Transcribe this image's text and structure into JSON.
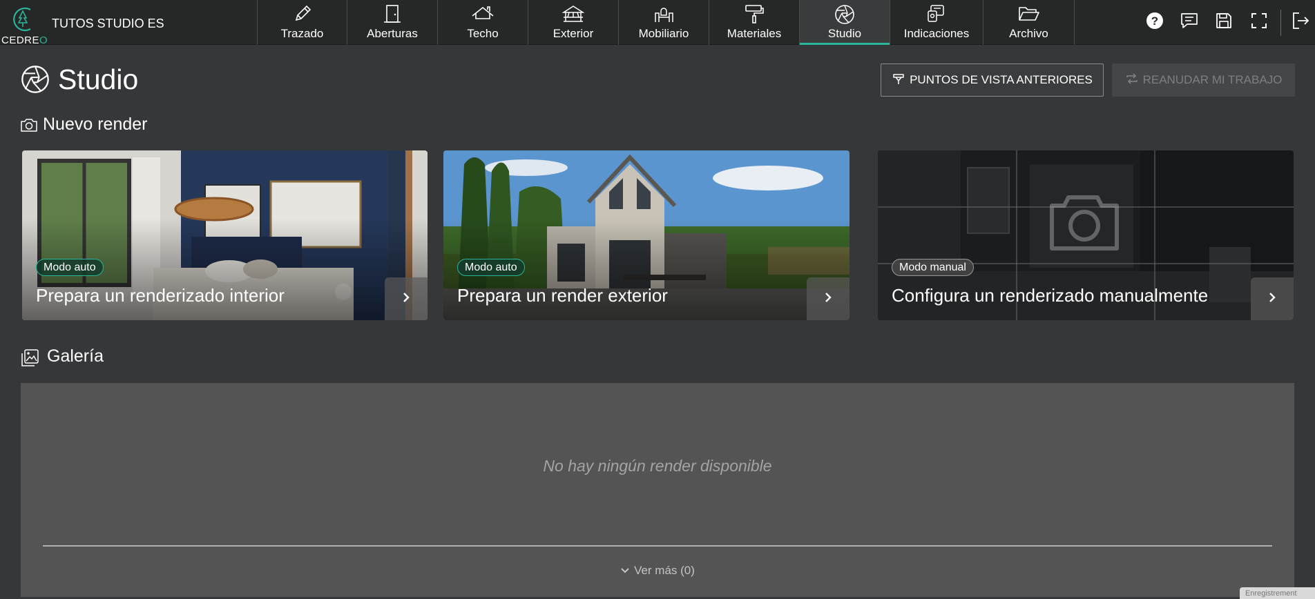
{
  "brand": {
    "logo_text_main": "CEDRE",
    "logo_text_accent": "O"
  },
  "project": {
    "name": "TUTOS STUDIO ES"
  },
  "nav": {
    "items": [
      {
        "label": "Trazado",
        "icon": "pencil-icon"
      },
      {
        "label": "Aberturas",
        "icon": "door-icon"
      },
      {
        "label": "Techo",
        "icon": "roof-icon"
      },
      {
        "label": "Exterior",
        "icon": "pergola-icon"
      },
      {
        "label": "Mobiliario",
        "icon": "furniture-icon"
      },
      {
        "label": "Materiales",
        "icon": "paint-roller-icon"
      },
      {
        "label": "Studio",
        "icon": "aperture-icon",
        "active": true
      },
      {
        "label": "Indicaciones",
        "icon": "annotations-icon"
      },
      {
        "label": "Archivo",
        "icon": "folder-icon"
      }
    ]
  },
  "tools": [
    "help-icon",
    "chat-icon",
    "save-icon",
    "fullscreen-icon",
    "logout-icon"
  ],
  "header": {
    "title": "Studio",
    "previous_views_label": "PUNTOS DE VISTA ANTERIORES",
    "resume_label": "REANUDAR MI TRABAJO"
  },
  "new_render": {
    "title": "Nuevo render",
    "cards": [
      {
        "badge": "Modo auto",
        "title": "Prepara un renderizado interior"
      },
      {
        "badge": "Modo auto",
        "title": "Prepara un render exterior"
      },
      {
        "badge": "Modo manual",
        "title": "Configura un renderizado manualmente"
      }
    ]
  },
  "gallery": {
    "title": "Galería",
    "empty_text": "No hay ningún render disponible",
    "see_more": "Ver más (0)"
  },
  "footer": {
    "partial_text": "Enregistrement"
  },
  "colors": {
    "accent": "#2bb59a",
    "background": "#363738",
    "topbar": "#262727",
    "gallery": "#545455"
  }
}
